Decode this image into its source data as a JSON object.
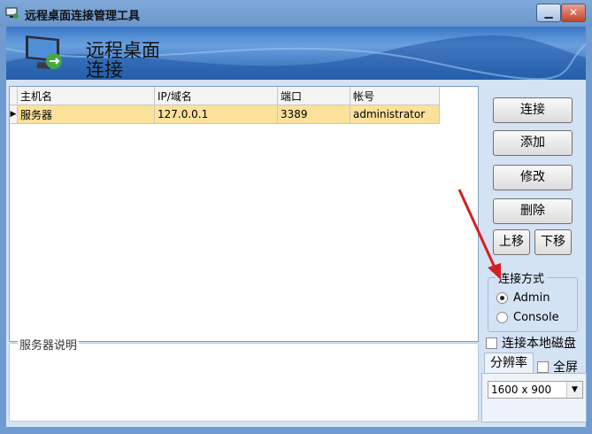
{
  "window": {
    "title": "远程桌面连接管理工具",
    "minimize_glyph": "▁",
    "close_glyph": "✕",
    "icon": "app-monitor-icon"
  },
  "banner": {
    "line1": "远程桌面",
    "line2": "连接",
    "icon": "remote-desktop-monitor-icon"
  },
  "table": {
    "columns": [
      "主机名",
      "IP/域名",
      "端口",
      "帐号"
    ],
    "rows": [
      {
        "selected": true,
        "marker": "▶",
        "cells": [
          "服务器",
          "127.0.0.1",
          "3389",
          "administrator"
        ]
      }
    ]
  },
  "description": {
    "label": "服务器说明"
  },
  "buttons": {
    "connect": "连接",
    "add": "添加",
    "edit": "修改",
    "delete": "删除",
    "move_up": "上移",
    "move_down": "下移"
  },
  "connect_mode": {
    "label": "连接方式",
    "options": [
      {
        "label": "Admin",
        "selected": true
      },
      {
        "label": "Console",
        "selected": false
      }
    ]
  },
  "local_disk": {
    "label": "连接本地磁盘",
    "checked": false
  },
  "resolution": {
    "tab_label": "分辨率",
    "fullscreen_label": "全屏",
    "fullscreen_checked": false,
    "value": "1600 x 900"
  },
  "colors": {
    "selected_row": "#fbe19a",
    "annotation_arrow": "#d42020"
  }
}
